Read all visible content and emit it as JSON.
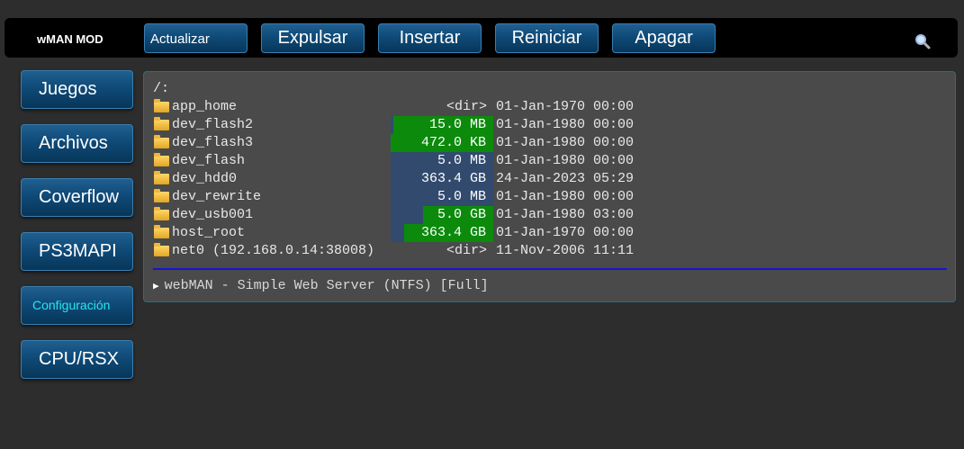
{
  "brand": "wMAN MOD",
  "topbar": {
    "buttons": [
      "Actualizar",
      "Expulsar",
      "Insertar",
      "Reiniciar",
      "Apagar"
    ],
    "search_icon": "search-icon"
  },
  "sidebar": {
    "items": [
      "Juegos",
      "Archivos",
      "Coverflow",
      "PS3MAPI",
      "Configuración",
      "CPU/RSX"
    ],
    "active": "Configuración"
  },
  "browser": {
    "path": "/:",
    "entries": [
      {
        "name": "app_home",
        "size": "<dir>",
        "fill_pct": 0,
        "date": "01-Jan-1970 00:00"
      },
      {
        "name": "dev_flash2",
        "size": "15.0 MB",
        "fill_pct": 97,
        "date": "01-Jan-1980 00:00"
      },
      {
        "name": "dev_flash3",
        "size": "472.0 KB",
        "fill_pct": 100,
        "date": "01-Jan-1980 00:00"
      },
      {
        "name": "dev_flash",
        "size": "5.0 MB",
        "fill_pct": 0,
        "date": "01-Jan-1980 00:00"
      },
      {
        "name": "dev_hdd0",
        "size": "363.4 GB",
        "fill_pct": 0,
        "date": "24-Jan-2023 05:29"
      },
      {
        "name": "dev_rewrite",
        "size": "5.0 MB",
        "fill_pct": 0,
        "date": "01-Jan-1980 00:00"
      },
      {
        "name": "dev_usb001",
        "size": "5.0 GB",
        "fill_pct": 68,
        "date": "01-Jan-1980 03:00"
      },
      {
        "name": "host_root",
        "size": "363.4 GB",
        "fill_pct": 87,
        "date": "01-Jan-1970 00:00"
      },
      {
        "name": "net0 (192.168.0.14:38008)",
        "size": "<dir>",
        "fill_pct": 0,
        "date": "11-Nov-2006 11:11"
      }
    ],
    "footer": "webMAN - Simple Web Server (NTFS) [Full]"
  },
  "colors": {
    "accent": "#0f4a78",
    "active_text": "#27e6f0",
    "free_fill": "#0c8a0c",
    "used_fill": "#324a6e",
    "divider": "#1414d8"
  }
}
